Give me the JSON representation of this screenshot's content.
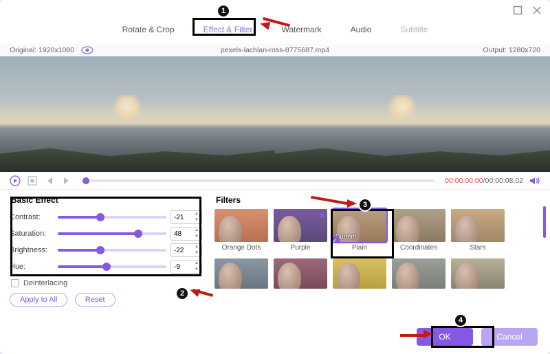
{
  "window": {
    "maximize_icon": "maximize",
    "close_icon": "close"
  },
  "tabs": {
    "rotate": "Rotate & Crop",
    "effect": "Effect & Filter",
    "watermark": "Watermark",
    "audio": "Audio",
    "subtitle": "Subtitle"
  },
  "meta": {
    "original": "Original: 1920x1080",
    "filename": "pexels-lachlan-ross-8775687.mp4",
    "output": "Output: 1280x720"
  },
  "time": {
    "current": "00:00:00.00",
    "duration": "/00:00:08.02"
  },
  "basic": {
    "title": "Basic Effect",
    "effects": [
      {
        "label": "Contrast:",
        "value": "-21",
        "pct": 39
      },
      {
        "label": "Saturation:",
        "value": "48",
        "pct": 74
      },
      {
        "label": "Brightness:",
        "value": "-22",
        "pct": 39
      },
      {
        "label": "Hue:",
        "value": "-9",
        "pct": 45
      }
    ],
    "deinterlacing": "Deinterlacing",
    "apply": "Apply to All",
    "reset": "Reset"
  },
  "filters": {
    "title": "Filters",
    "row1": [
      {
        "name": "Orange Dots",
        "cls": "th-orange"
      },
      {
        "name": "Purple",
        "cls": "th-purple",
        "star": true
      },
      {
        "name": "Plain",
        "cls": "th-plain",
        "selected": true,
        "current": "Current",
        "check": true
      },
      {
        "name": "Coordinates",
        "cls": "th-coord"
      },
      {
        "name": "Stars",
        "cls": "th-stars"
      }
    ]
  },
  "footer": {
    "ok": "OK",
    "cancel": "Cancel"
  },
  "annotations": {
    "n1": "1",
    "n2": "2",
    "n3": "3",
    "n4": "4"
  }
}
